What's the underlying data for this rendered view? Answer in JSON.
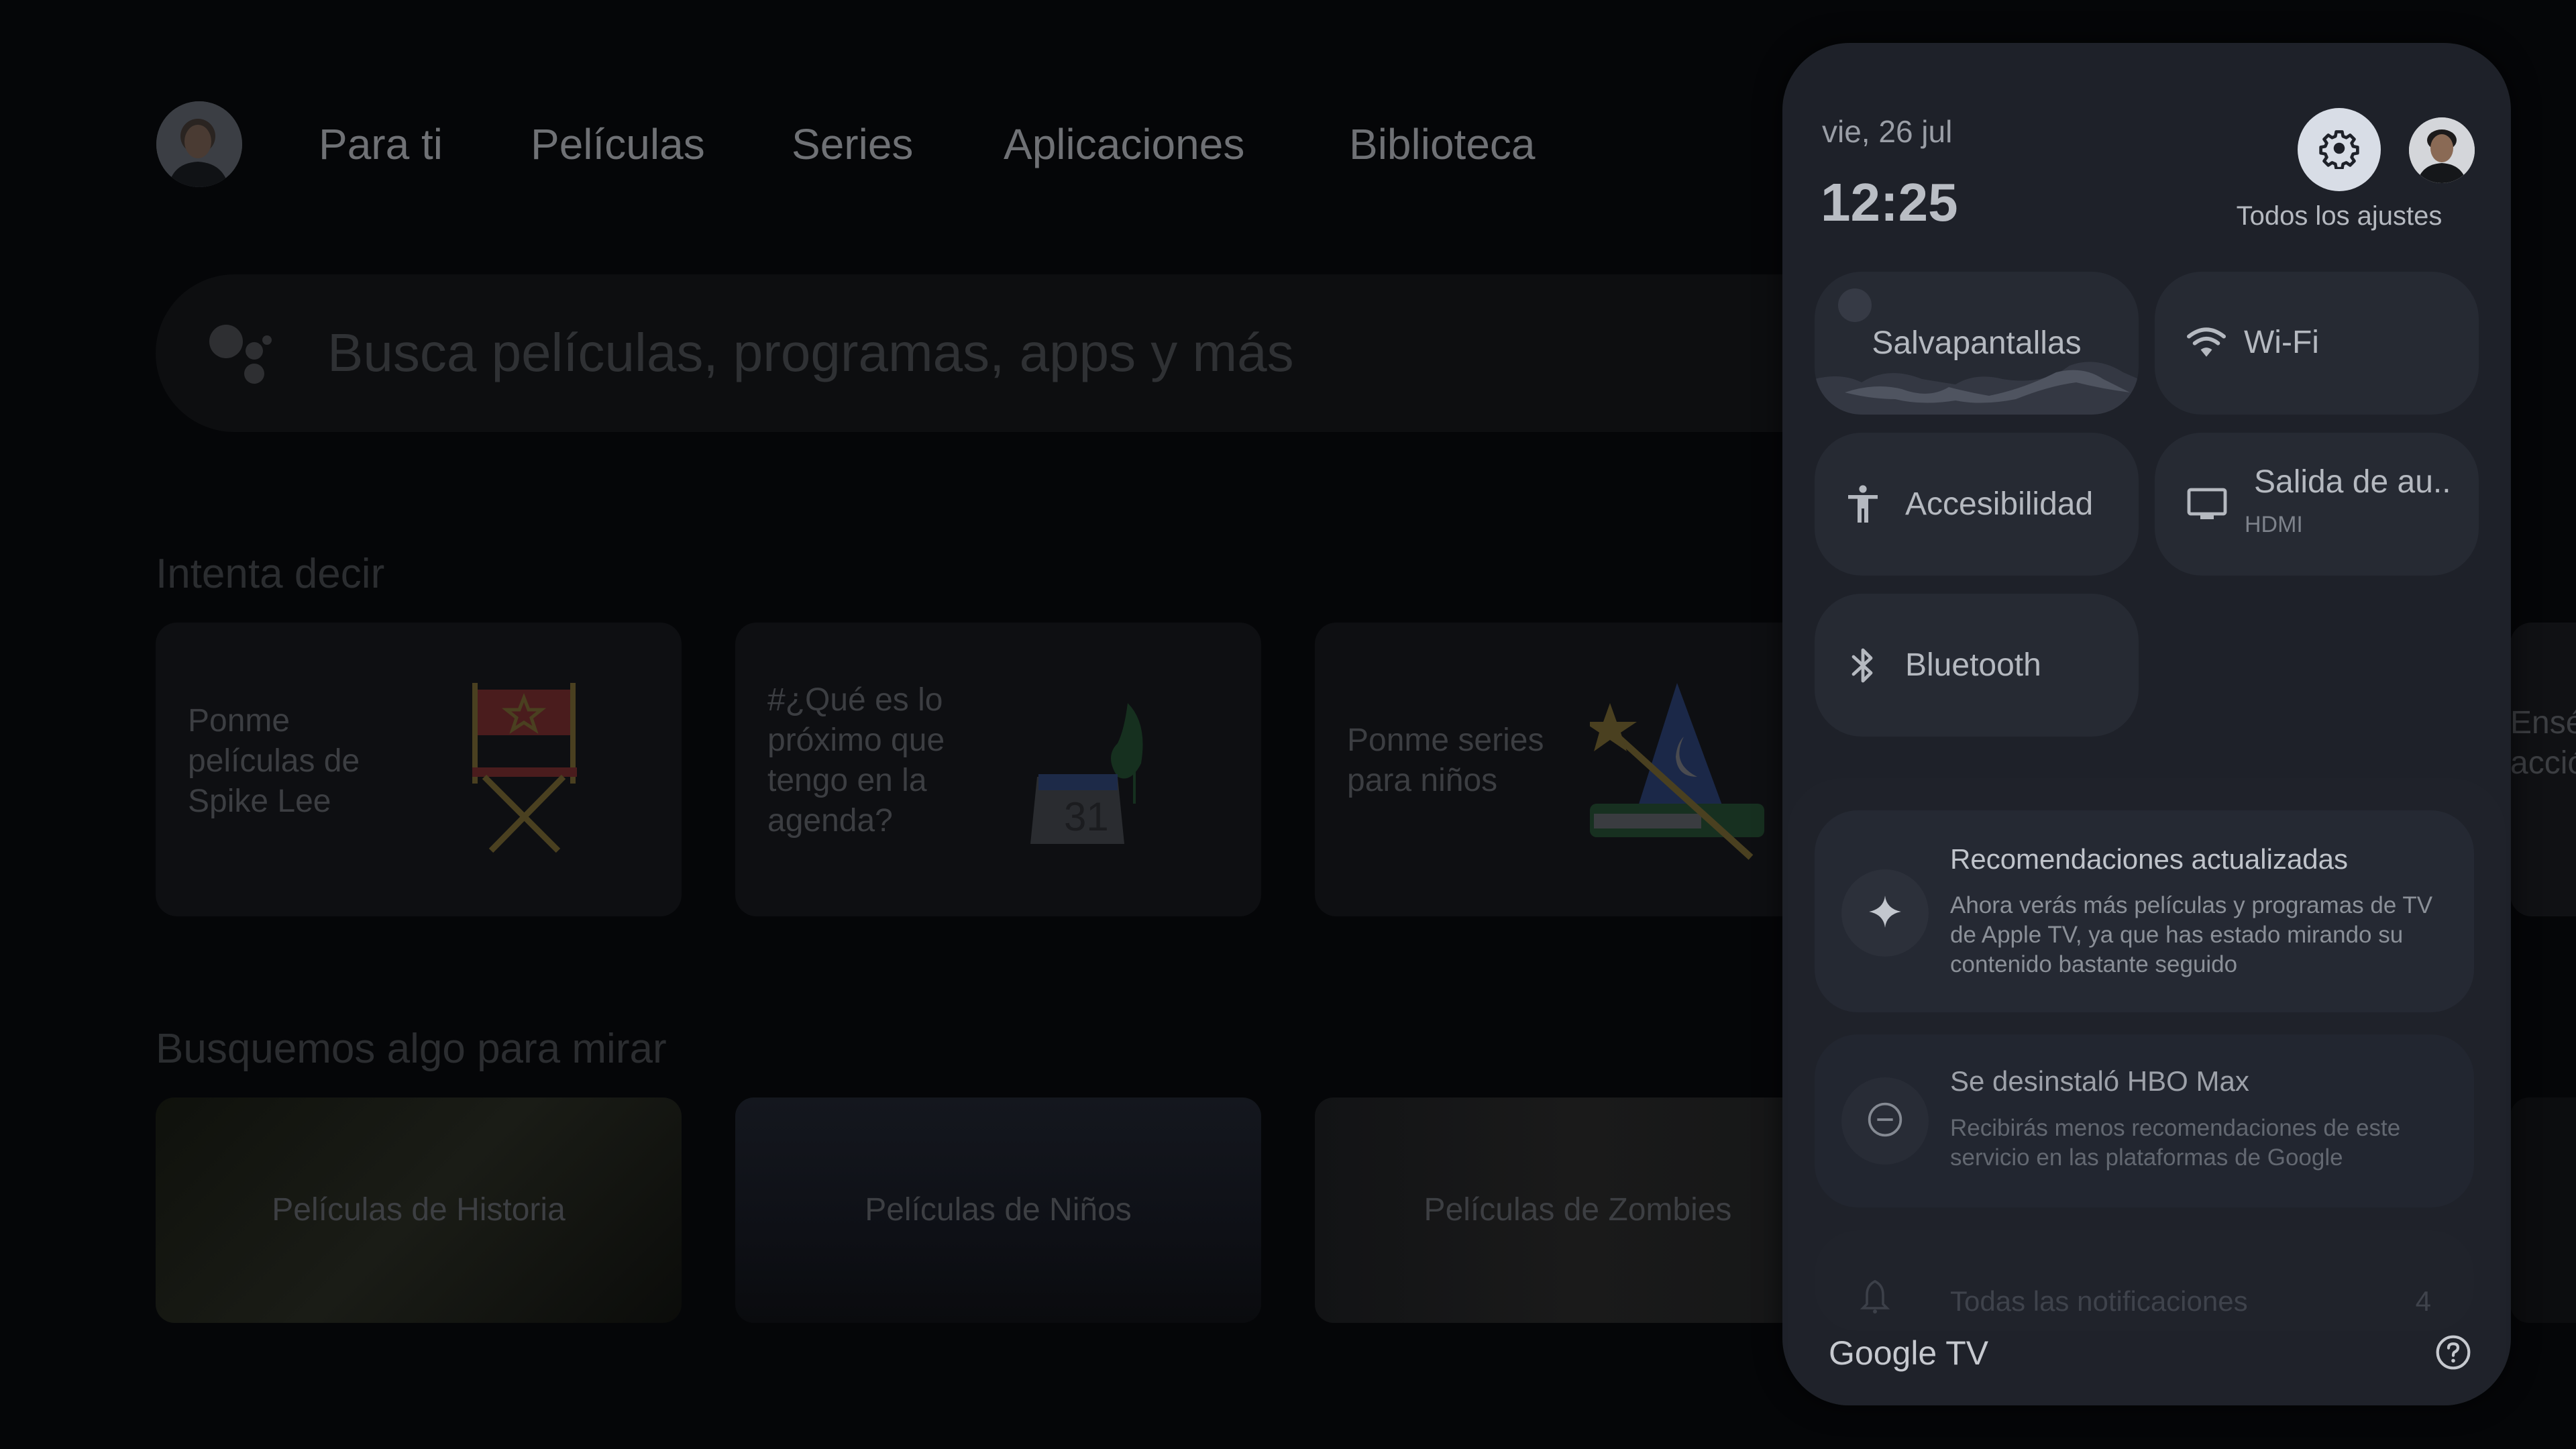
{
  "home": {
    "nav": {
      "avatar_icon": "user-avatar",
      "items": [
        {
          "label": "Para ti"
        },
        {
          "label": "Películas"
        },
        {
          "label": "Series"
        },
        {
          "label": "Aplicaciones"
        },
        {
          "label": "Biblioteca"
        }
      ]
    },
    "search": {
      "icon": "google-assistant-icon",
      "placeholder": "Busca películas, programas, apps y más"
    },
    "try_saying": {
      "title": "Intenta decir",
      "cards": [
        {
          "text": "Ponme películas de Spike Lee",
          "illustration": "director-chair"
        },
        {
          "text": "#¿Qué es lo próximo que tengo en la agenda?",
          "illustration": "calendar-plant"
        },
        {
          "text": "Ponme series para niños",
          "illustration": "wizard-hat-wand"
        },
        {
          "text": "Enséñame películas de acción",
          "illustration": ""
        }
      ]
    },
    "browse": {
      "title": "Busquemos algo para mirar",
      "cards": [
        {
          "label": "Películas de Historia"
        },
        {
          "label": "Películas de Niños"
        },
        {
          "label": "Películas de Zombies"
        }
      ]
    }
  },
  "quick_settings": {
    "date": "vie, 26 jul",
    "time": "12:25",
    "settings_label": "Todos los ajustes",
    "settings_icon": "gear-icon",
    "profile_icon": "user-avatar",
    "tiles": [
      {
        "label": "Salvapantallas",
        "icon": "screensaver-landscape"
      },
      {
        "label": "Wi-Fi",
        "icon": "wifi-icon"
      },
      {
        "label": "Accesibilidad",
        "icon": "accessibility-icon"
      },
      {
        "label": "Salida de au..",
        "sublabel": "HDMI",
        "icon": "tv-monitor-icon"
      },
      {
        "label": "Bluetooth",
        "icon": "bluetooth-icon"
      }
    ],
    "notifications": [
      {
        "icon": "sparkle-icon",
        "title": "Recomendaciones actualizadas",
        "body": "Ahora verás más películas y programas de TV de Apple TV, ya que has estado mirando su contenido bastante seguido"
      },
      {
        "icon": "minus-circle-icon",
        "title": "Se desinstaló HBO Max",
        "body": "Recibirás menos recomendaciones de este servicio en las plataformas de Google"
      }
    ],
    "all_notifications": {
      "label": "Todas las notificaciones",
      "count": "4",
      "icon": "bell-icon"
    },
    "footer": {
      "brand": "Google TV",
      "help_icon": "help-circle-icon"
    }
  },
  "colors": {
    "panel_bg": "#1e2129",
    "tile_bg": "#262a33",
    "text_primary": "#b9bdc4",
    "settings_button_bg": "#d8dde6"
  }
}
